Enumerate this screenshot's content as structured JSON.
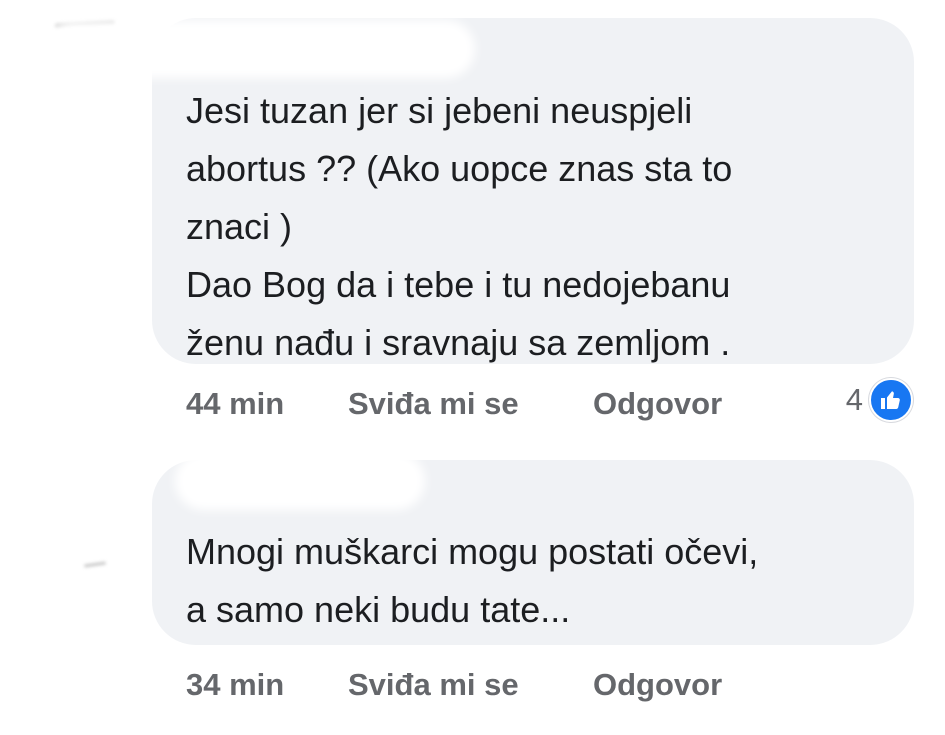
{
  "comments": [
    {
      "text": "Jesi tuzan jer si jebeni neuspjeli\nabortus ?? (Ako uopce znas sta to\nznaci )\nDao Bog da i tebe i tu nedojebanu\nženu nađu i sravnaju sa zemljom .",
      "time": "44 min",
      "like_label": "Sviđa mi se",
      "reply_label": "Odgovor",
      "reaction_count": "4",
      "reaction_icon": "like-thumbs-up-icon"
    },
    {
      "text": "Mnogi muškarci mogu postati očevi,\na samo neki budu tate...",
      "time": "34 min",
      "like_label": "Sviđa mi se",
      "reply_label": "Odgovor"
    }
  ],
  "colors": {
    "bubble_bg": "#f0f2f5",
    "text": "#1c1e21",
    "meta_text": "#65676b",
    "like_badge": "#1877f2"
  }
}
